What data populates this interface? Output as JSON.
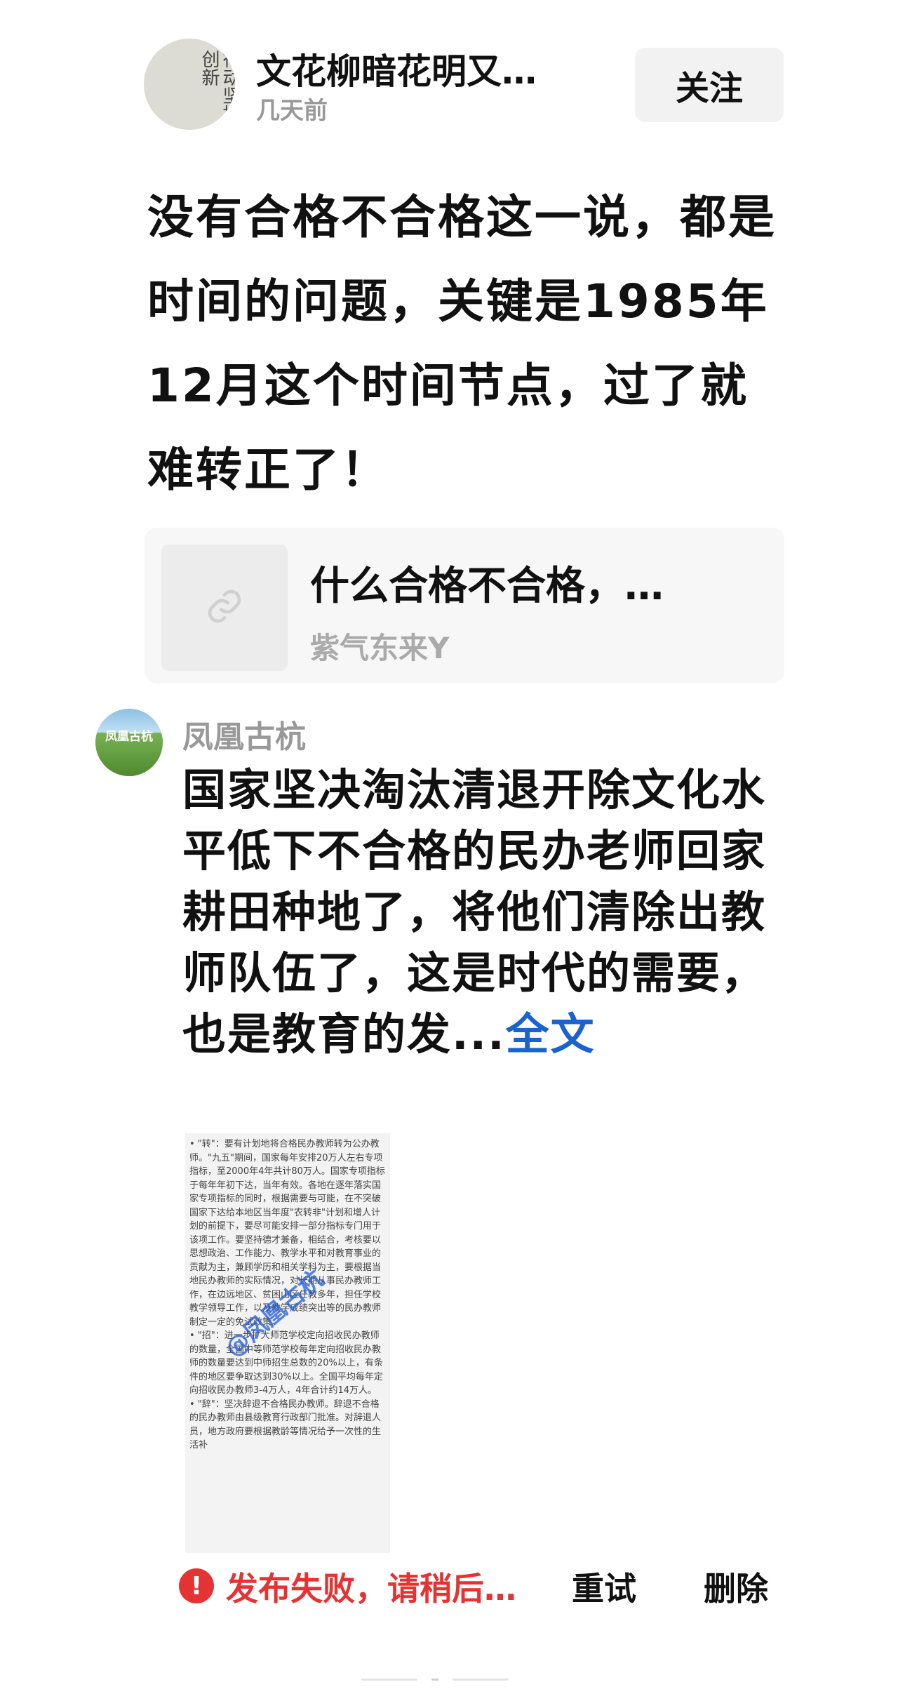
{
  "post": {
    "author_name": "文花柳暗花明又…",
    "time": "几天前",
    "follow_label": "关注",
    "avatar_text": "行动坚持创新",
    "main_text": "没有合格不合格这一说，都是时间的问题，关键是1985年12月这个时间节点，过了就难转正了！"
  },
  "quote": {
    "title": "什么合格不合格，…",
    "author": "紫气东来Y",
    "thumb_icon": "link-icon"
  },
  "comment": {
    "avatar_text": "凤凰古杭",
    "user": "凤凰古杭",
    "text": "国家坚决淘汰清退开除文化水平低下不合格的民办老师回家耕田种地了，将他们清除出教师队伍了，这是时代的需要，也是教育的发...",
    "more_label": "全文",
    "image_text": "• \"转\"：要有计划地将合格民办教师转为公办教师。\"九五\"期间，国家每年安排20万人左右专项指标，至2000年4年共计80万人。国家专项指标于每年年初下达，当年有效。各地在逐年落实国家专项指标的同时，根据需要与可能，在不突破国家下达给本地区当年度\"农转非\"计划和增人计划的前提下，要尽可能安排一部分指标专门用于该项工作。要坚持德才兼备，相结合，考核要以思想政治、工作能力、教学水平和对教育事业的贡献为主，兼顾学历和相关学科为主，要根据当地民办教师的实际情况，对长期从事民办教师工作，在边远地区、贫困山区任教多年，担任学校教学领导工作，以及教学成绩突出等的民办教师制定一定的免试政策。\n• \"招\"：进一步扩大师范学校定向招收民办教师的数量，全国中等师范学校每年定向招收民办教师的数量要达到中师招生总数的20%以上，有条件的地区要争取达到30%以上。全国平均每年定向招收民办教师3-4万人，4年合计约14万人。\n• \"辞\"：坚决辞退不合格民办教师。辞退不合格的民办教师由县级教育行政部门批准。对辞退人员，地方政府要根据教龄等情况给予一次性的生活补",
    "watermark": "@凤凰古杭"
  },
  "status": {
    "icon": "!",
    "message": "发布失败，请稍后…",
    "retry_label": "重试",
    "delete_label": "删除",
    "color": "#e53333"
  },
  "colors": {
    "link": "#1a62d0",
    "muted": "#999999"
  }
}
